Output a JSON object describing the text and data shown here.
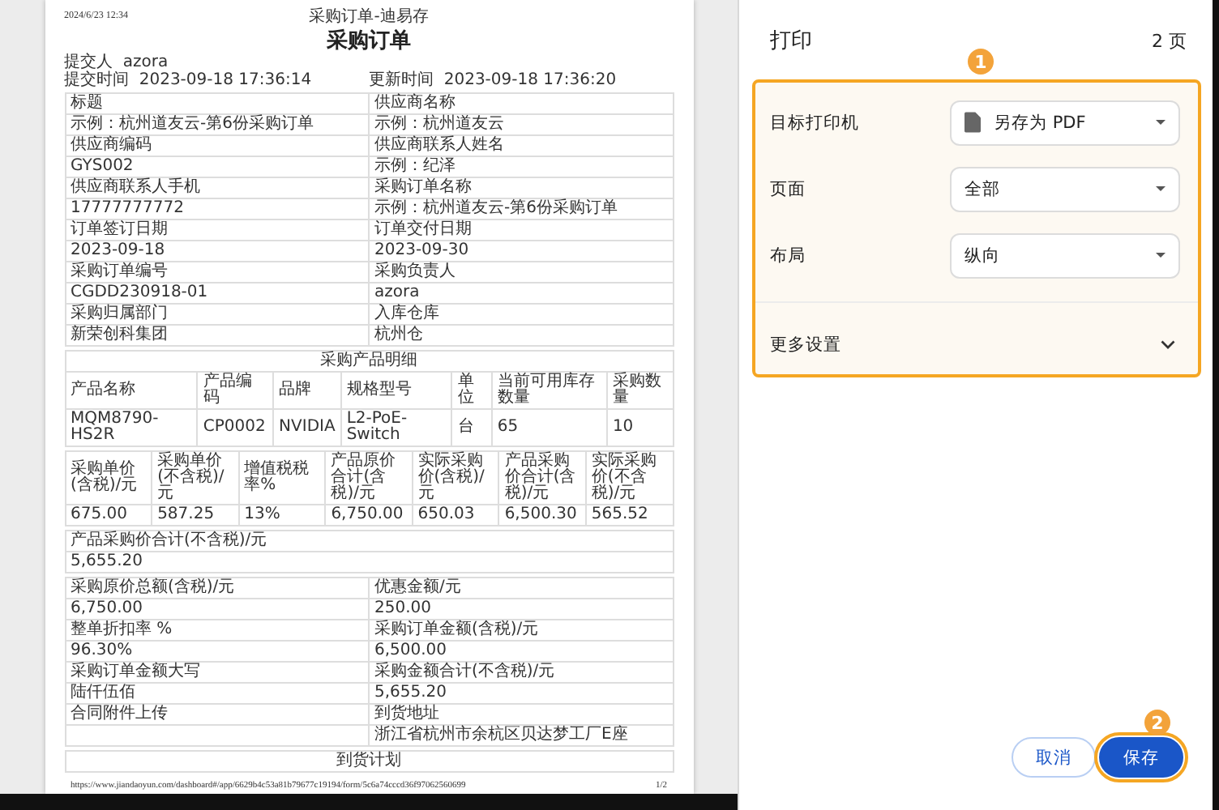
{
  "preview": {
    "header": {
      "date": "2024/6/23 12:34",
      "title": "采购订单-迪易存"
    },
    "document": {
      "title": "采购订单",
      "meta": [
        {
          "label": "提交人",
          "value": "azora"
        },
        {
          "label": "提交时间",
          "value": "2023-09-18 17:36:14"
        },
        {
          "label": "更新时间",
          "value": "2023-09-18 17:36:20"
        }
      ],
      "basic_rows": [
        [
          "标题",
          "供应商名称"
        ],
        [
          "示例：杭州道友云-第6份采购订单",
          "示例：杭州道友云"
        ],
        [
          "供应商编码",
          "供应商联系人姓名"
        ],
        [
          "GYS002",
          "示例：纪泽"
        ],
        [
          "供应商联系人手机",
          "采购订单名称"
        ],
        [
          "17777777772",
          "示例：杭州道友云-第6份采购订单"
        ],
        [
          "订单签订日期",
          "订单交付日期"
        ],
        [
          "2023-09-18",
          "2023-09-30"
        ],
        [
          "采购订单编号",
          "采购负责人"
        ],
        [
          "CGDD230918-01",
          "azora"
        ],
        [
          "采购归属部门",
          "入库仓库"
        ],
        [
          "新荣创科集团",
          "杭州仓"
        ]
      ],
      "product_table": {
        "title": "采购产品明细",
        "columns": [
          "产品名称",
          "产品编码",
          "品牌",
          "规格型号",
          "单位",
          "当前可用库存数量",
          "采购数量"
        ],
        "rows": [
          [
            "MQM8790-HS2R",
            "CP0002",
            "NVIDIA",
            "L2-PoE-Switch",
            "台",
            "65",
            "10"
          ]
        ]
      },
      "price_table": {
        "columns": [
          "采购单价(含税)/元",
          "采购单价(不含税)/元",
          "增值税税率%",
          "产品原价合计(含税)/元",
          "实际采购价(含税)/元",
          "产品采购价合计(含税)/元",
          "实际采购价(不含税)/元"
        ],
        "rows": [
          [
            "675.00",
            "587.25",
            "13%",
            "6,750.00",
            "650.03",
            "6,500.30",
            "565.52"
          ]
        ]
      },
      "total_untaxed": {
        "label": "产品采购价合计(不含税)/元",
        "value": "5,655.20"
      },
      "summary_rows": [
        [
          "采购原价总额(含税)/元",
          "优惠金额/元"
        ],
        [
          "6,750.00",
          "250.00"
        ],
        [
          "整单折扣率 %",
          "采购订单金额(含税)/元"
        ],
        [
          "96.30%",
          "6,500.00"
        ],
        [
          "采购订单金额大写",
          "采购金额合计(不含税)/元"
        ],
        [
          "陆仟伍佰",
          "5,655.20"
        ],
        [
          "合同附件上传",
          "到货地址"
        ],
        [
          null,
          "浙江省杭州市余杭区贝达梦工厂E座"
        ]
      ],
      "delivery_plan": "到货计划"
    },
    "footer": {
      "url": "https://www.jiandaoyun.com/dashboard#/app/6629b4c53a81b79677c19194/form/5c6a74cccd36f97062560699",
      "page": "1/2"
    }
  },
  "print_panel": {
    "title": "打印",
    "page_count": "2 页",
    "settings_callout": "1",
    "settings": [
      {
        "label": "目标打印机",
        "value": "另存为 PDF",
        "kind": "destination"
      },
      {
        "label": "页面",
        "value": "全部",
        "kind": "select"
      },
      {
        "label": "布局",
        "value": "纵向",
        "kind": "select"
      }
    ],
    "more_settings": {
      "label": "更多设置",
      "expanded": false
    },
    "buttons_callout": "2",
    "buttons": [
      {
        "label": "取消",
        "kind": "secondary"
      },
      {
        "label": "保存",
        "kind": "primary"
      }
    ]
  }
}
